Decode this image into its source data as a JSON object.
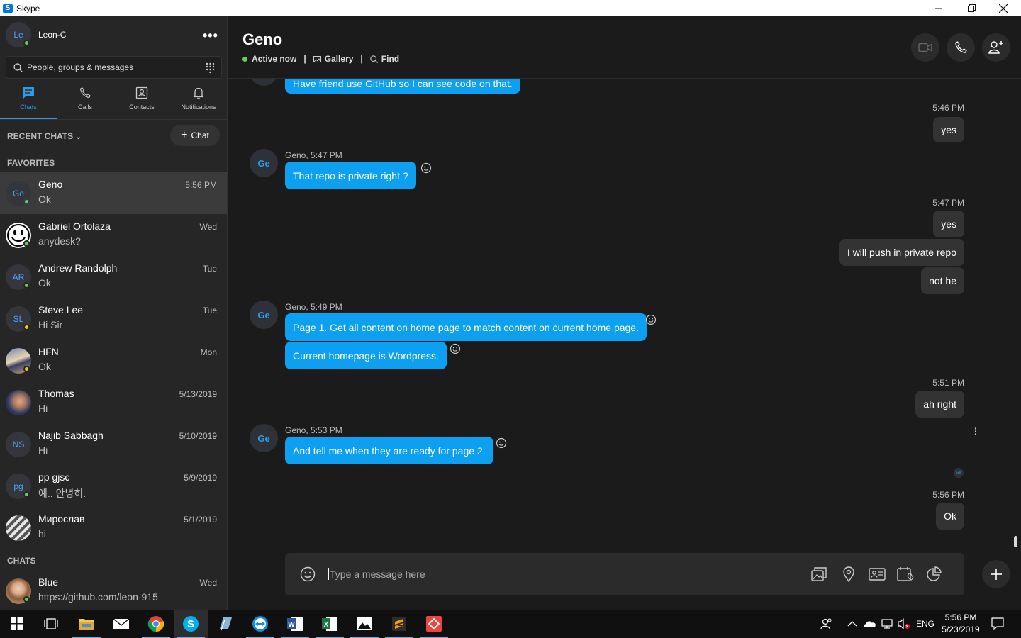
{
  "window": {
    "title": "Skype"
  },
  "profile": {
    "initials": "Le",
    "name": "Leon-C"
  },
  "search": {
    "placeholder": "People, groups & messages"
  },
  "nav": [
    {
      "label": "Chats",
      "icon": "chat-icon"
    },
    {
      "label": "Calls",
      "icon": "phone-icon"
    },
    {
      "label": "Contacts",
      "icon": "contacts-icon"
    },
    {
      "label": "Notifications",
      "icon": "bell-icon"
    }
  ],
  "sidebar": {
    "recent_header": "RECENT CHATS",
    "new_chat_label": "Chat",
    "favorites_header": "FAVORITES",
    "chats_header": "CHATS"
  },
  "favorites": [
    {
      "name": "Geno",
      "message": "Ok",
      "time": "5:56 PM",
      "initials": "Ge",
      "status": "online"
    },
    {
      "name": "Gabriel Ortolaza",
      "message": "anydesk?",
      "time": "Wed",
      "initials": "",
      "status": "online"
    },
    {
      "name": "Andrew Randolph",
      "message": "Ok",
      "time": "Tue",
      "initials": "AR",
      "status": "online"
    },
    {
      "name": "Steve Lee",
      "message": "Hi Sir",
      "time": "Tue",
      "initials": "SL",
      "status": "away"
    },
    {
      "name": "HFN",
      "message": "Ok",
      "time": "Mon",
      "initials": "",
      "status": "away"
    },
    {
      "name": "Thomas",
      "message": "Hi",
      "time": "5/13/2019",
      "initials": "",
      "status": ""
    },
    {
      "name": "Najib Sabbagh",
      "message": "Hi",
      "time": "5/10/2019",
      "initials": "NS",
      "status": ""
    },
    {
      "name": "pp gjsc",
      "message": "예.. 안녕히.",
      "time": "5/9/2019",
      "initials": "pg",
      "status": "online"
    },
    {
      "name": "Мирослав",
      "message": "hi",
      "time": "5/1/2019",
      "initials": "",
      "status": ""
    }
  ],
  "chats": [
    {
      "name": "Blue",
      "message": "https://github.com/leon-915",
      "time": "Wed",
      "initials": "",
      "status": "online"
    }
  ],
  "conversation": {
    "title": "Geno",
    "status": "Active now",
    "gallery": "Gallery",
    "find": "Find",
    "separator": "|",
    "partial_message": "Have friend use GitHub so I can see code on that.",
    "messages": [
      {
        "time": "5:46 PM",
        "texts": [
          "yes"
        ]
      },
      {
        "sender": "Geno, 5:47 PM",
        "initials": "Ge",
        "texts": [
          "That repo is private right ?"
        ]
      },
      {
        "time": "5:47 PM",
        "texts": [
          "yes",
          "I will push in private repo",
          "not he"
        ]
      },
      {
        "sender": "Geno, 5:49 PM",
        "initials": "Ge",
        "texts": [
          "Page 1. Get all content on home page to match content on current home page.",
          "Current homepage is Wordpress."
        ]
      },
      {
        "time": "5:51 PM",
        "texts": [
          "ah right"
        ]
      },
      {
        "sender": "Geno, 5:53 PM",
        "initials": "Ge",
        "texts": [
          "And tell me when they are ready for page 2."
        ]
      },
      {
        "time": "5:56 PM",
        "texts": [
          "Ok"
        ]
      }
    ],
    "read_receipt": "Ge"
  },
  "composer": {
    "placeholder": "Type a message here"
  },
  "taskbar": {
    "language": "ENG",
    "time": "5:56 PM",
    "date": "5/23/2019"
  },
  "colors": {
    "accent": "#0d9ff0",
    "outgoing": "#333333",
    "background": "#1b1b1b",
    "sidebar": "#262626"
  }
}
